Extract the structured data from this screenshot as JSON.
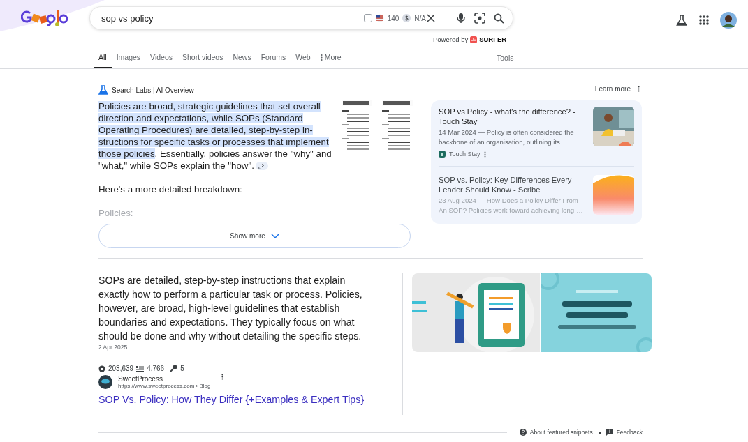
{
  "search": {
    "value": "sop vs policy",
    "extension": {
      "checked": false,
      "volume": "140",
      "cpc": "N/A"
    },
    "powered_by": "Powered by",
    "brand": "SURFER"
  },
  "tabs": [
    {
      "label": "All",
      "selected": true
    },
    {
      "label": "Images",
      "selected": false
    },
    {
      "label": "Videos",
      "selected": false
    },
    {
      "label": "Short videos",
      "selected": false
    },
    {
      "label": "News",
      "selected": false
    },
    {
      "label": "Forums",
      "selected": false
    },
    {
      "label": "Web",
      "selected": false
    },
    {
      "label": "More",
      "selected": false,
      "kind": "menu"
    }
  ],
  "tools": "Tools",
  "ai_overview": {
    "title": "Search Labs | AI Overview",
    "learn_more": "Learn more",
    "paragraph": [
      {
        "text": "Policies are broad, strategic guidelines that set overall direction and expectations, while SOPs (Standard Operating Procedures) are detailed, step-by-step in-structions for specific tasks or processes that implement those policies",
        "highlighted": true
      },
      {
        "text": ". Essentially, policies answer the \"why\" and \"what,\" while SOPs explain the \"how\".",
        "highlighted": false
      }
    ],
    "lines": [
      {
        "text": "Here's a more detailed breakdown:",
        "faded": false
      },
      {
        "text": "Policies:",
        "faded": true
      }
    ],
    "sources": [
      {
        "title": "SOP vs Policy - what's the difference? - Touch Stay",
        "snippet": "14 Mar 2024 — Policy is often considered the backbone of an organisation, outlining its…",
        "site": "Touch Stay",
        "faded": false
      },
      {
        "title": "SOP vs. Policy: Key Differences Every Leader Should Know - Scribe",
        "snippet": "23 Aug 2024 — How Does a Policy Differ From An SOP? Policies work toward achieving long-…",
        "faded": true,
        "kind": "gradient"
      }
    ],
    "show_more": "Show more"
  },
  "snippet": {
    "text": "SOPs are detailed, step-by-step instructions that explain exactly how to perform a particular task or process. Policies, however, are broad, high-level guidelines that establish boundaries and expectations. They typically focus on what should be done and why without detailing the specific steps.",
    "date": "2 Apr 2025",
    "stats": [
      {
        "kind": "chat",
        "value": "203,639"
      },
      {
        "kind": "list",
        "value": "4,766"
      },
      {
        "kind": "key",
        "value": "5"
      }
    ],
    "site": "SweetProcess",
    "url": "https://www.sweetprocess.com › Blog",
    "link": "SOP Vs. Policy: How They Differ {+Examples & Expert Tips}"
  },
  "footer": {
    "about": "About featured snippets",
    "feedback": "Feedback"
  }
}
